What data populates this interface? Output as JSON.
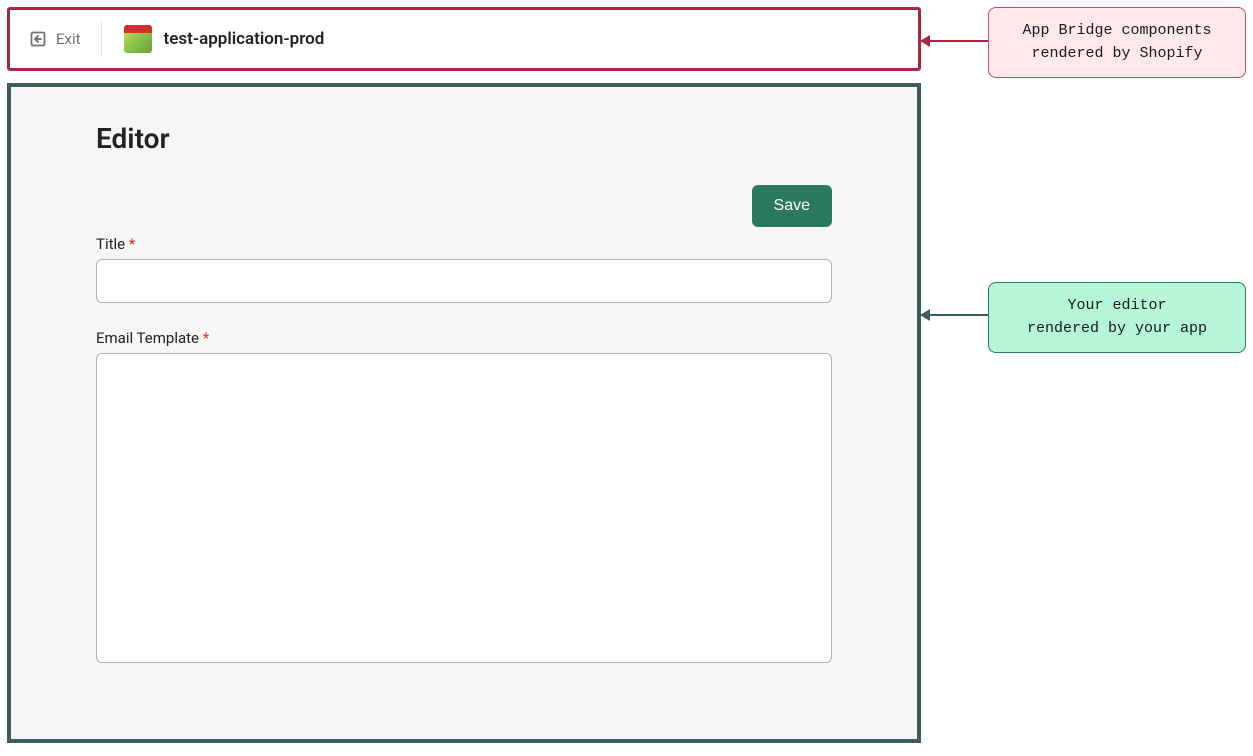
{
  "topbar": {
    "exit_label": "Exit",
    "app_name": "test-application-prod"
  },
  "editor": {
    "heading": "Editor",
    "save_label": "Save",
    "title_label": "Title",
    "title_value": "",
    "template_label": "Email Template",
    "template_value": "",
    "required_marker": "*"
  },
  "callouts": {
    "top": "App Bridge components\nrendered by Shopify",
    "mid": "Your editor\nrendered by your app"
  }
}
